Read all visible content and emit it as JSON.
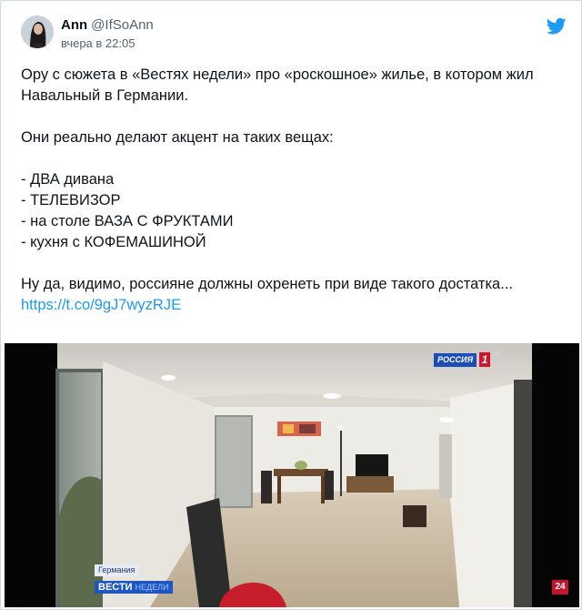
{
  "author": {
    "display_name": "Ann",
    "handle": "@IfSoAnn",
    "timestamp": "вчера в 22:05",
    "avatar_icon": "avatar-photo"
  },
  "platform_icon": "twitter-bird-icon",
  "tweet": {
    "paragraph1": "Ору с сюжета в «Вестях недели» про «роскошное» жилье, в котором жил Навальный в Германии.",
    "paragraph2": "Они реально делают акцент на таких вещах:",
    "list": [
      "- ДВА дивана",
      "- ТЕЛЕВИЗОР",
      "- на столе ВАЗА С ФРУКТАМИ",
      "- кухня с КОФЕМАШИНОЙ"
    ],
    "paragraph3": "Ну да, видимо, россияне должны охренеть при виде такого достатка...",
    "link": "https://t.co/9gJ7wyzRJE"
  },
  "video": {
    "channel_logo": "РОССИЯ",
    "channel_number": "1",
    "channel_hd": "HD",
    "location_caption": "Германия",
    "show_title": "ВЕСТИ",
    "show_subtitle": "НЕДЕЛИ",
    "corner_badge": "24"
  },
  "colors": {
    "link": "#1d9bf0",
    "twitter_blue": "#1d9bf0",
    "channel_blue": "#1c4fb6",
    "channel_red": "#d4122c"
  }
}
